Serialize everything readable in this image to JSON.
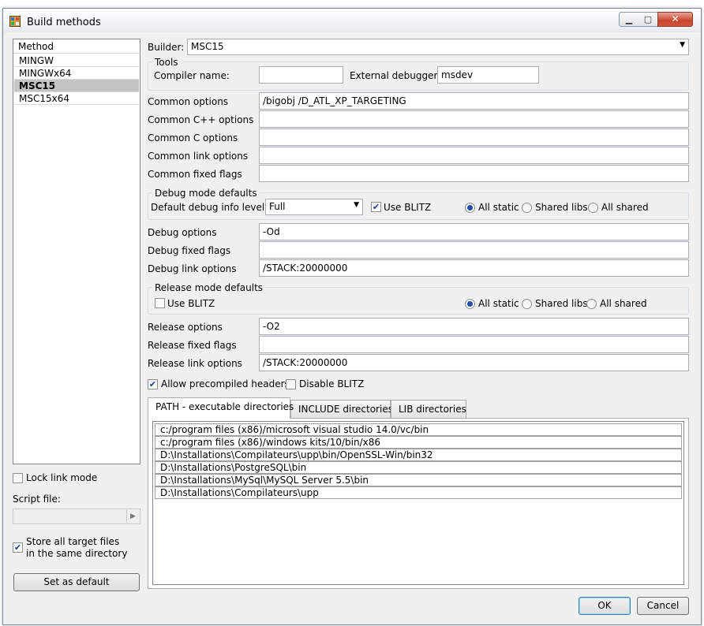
{
  "window": {
    "title": "Build methods"
  },
  "methods": {
    "header": "Method",
    "items": [
      "MINGW",
      "MINGWx64",
      "MSC15",
      "MSC15x64"
    ],
    "selected_index": 2
  },
  "left_bottom": {
    "lock_link_label": "Lock link mode",
    "lock_link_checked": false,
    "script_label": "Script file:",
    "script_value": "",
    "store_line1": "Store all target files",
    "store_line2": "in the same directory",
    "store_checked": true,
    "set_default_label": "Set as default"
  },
  "builder": {
    "label": "Builder:",
    "value": "MSC15"
  },
  "tools": {
    "title": "Tools",
    "compiler_label": "Compiler name:",
    "compiler_value": "",
    "debugger_label": "External debugger:",
    "debugger_value": "msdev"
  },
  "common": {
    "options_label": "Common options",
    "options_value": "/bigobj /D_ATL_XP_TARGETING",
    "cpp_label": "Common C++ options",
    "cpp_value": "",
    "c_label": "Common C options",
    "c_value": "",
    "link_label": "Common link options",
    "link_value": "",
    "fixed_label": "Common fixed flags",
    "fixed_value": ""
  },
  "debug_defaults": {
    "title": "Debug mode defaults",
    "info_label": "Default debug info level:",
    "info_value": "Full",
    "blitz_label": "Use BLITZ",
    "blitz_checked": true,
    "all_static": "All static",
    "shared_libs": "Shared libs",
    "all_shared": "All shared",
    "selected": "all_static"
  },
  "debug": {
    "options_label": "Debug options",
    "options_value": "-Od",
    "fixed_label": "Debug fixed flags",
    "fixed_value": "",
    "link_label": "Debug link options",
    "link_value": "/STACK:20000000"
  },
  "release_defaults": {
    "title": "Release mode defaults",
    "blitz_label": "Use BLITZ",
    "blitz_checked": false,
    "all_static": "All static",
    "shared_libs": "Shared libs",
    "all_shared": "All shared",
    "selected": "all_static"
  },
  "release": {
    "options_label": "Release options",
    "options_value": "-O2",
    "fixed_label": "Release fixed flags",
    "fixed_value": "",
    "link_label": "Release link options",
    "link_value": "/STACK:20000000"
  },
  "flags": {
    "precompiled_label": "Allow precompiled headers",
    "precompiled_checked": true,
    "disable_blitz_label": "Disable BLITZ",
    "disable_blitz_checked": false
  },
  "tabs": [
    "PATH - executable directories",
    "INCLUDE directories",
    "LIB directories"
  ],
  "active_tab": 0,
  "paths": [
    "c:/program files (x86)/microsoft visual studio 14.0/vc/bin",
    "c:/program files (x86)/windows kits/10/bin/x86",
    "D:\\Installations\\Compilateurs\\upp\\bin/OpenSSL-Win/bin32",
    "D:\\Installations\\PostgreSQL\\bin",
    "D:\\Installations\\MySql\\MySQL Server 5.5\\bin",
    "D:\\Installations\\Compilateurs\\upp"
  ],
  "buttons": {
    "ok": "OK",
    "cancel": "Cancel"
  },
  "icons": {
    "app": "build-methods-icon",
    "dropdown": "chevron-down-icon",
    "scroll": "chevron-right-icon"
  }
}
